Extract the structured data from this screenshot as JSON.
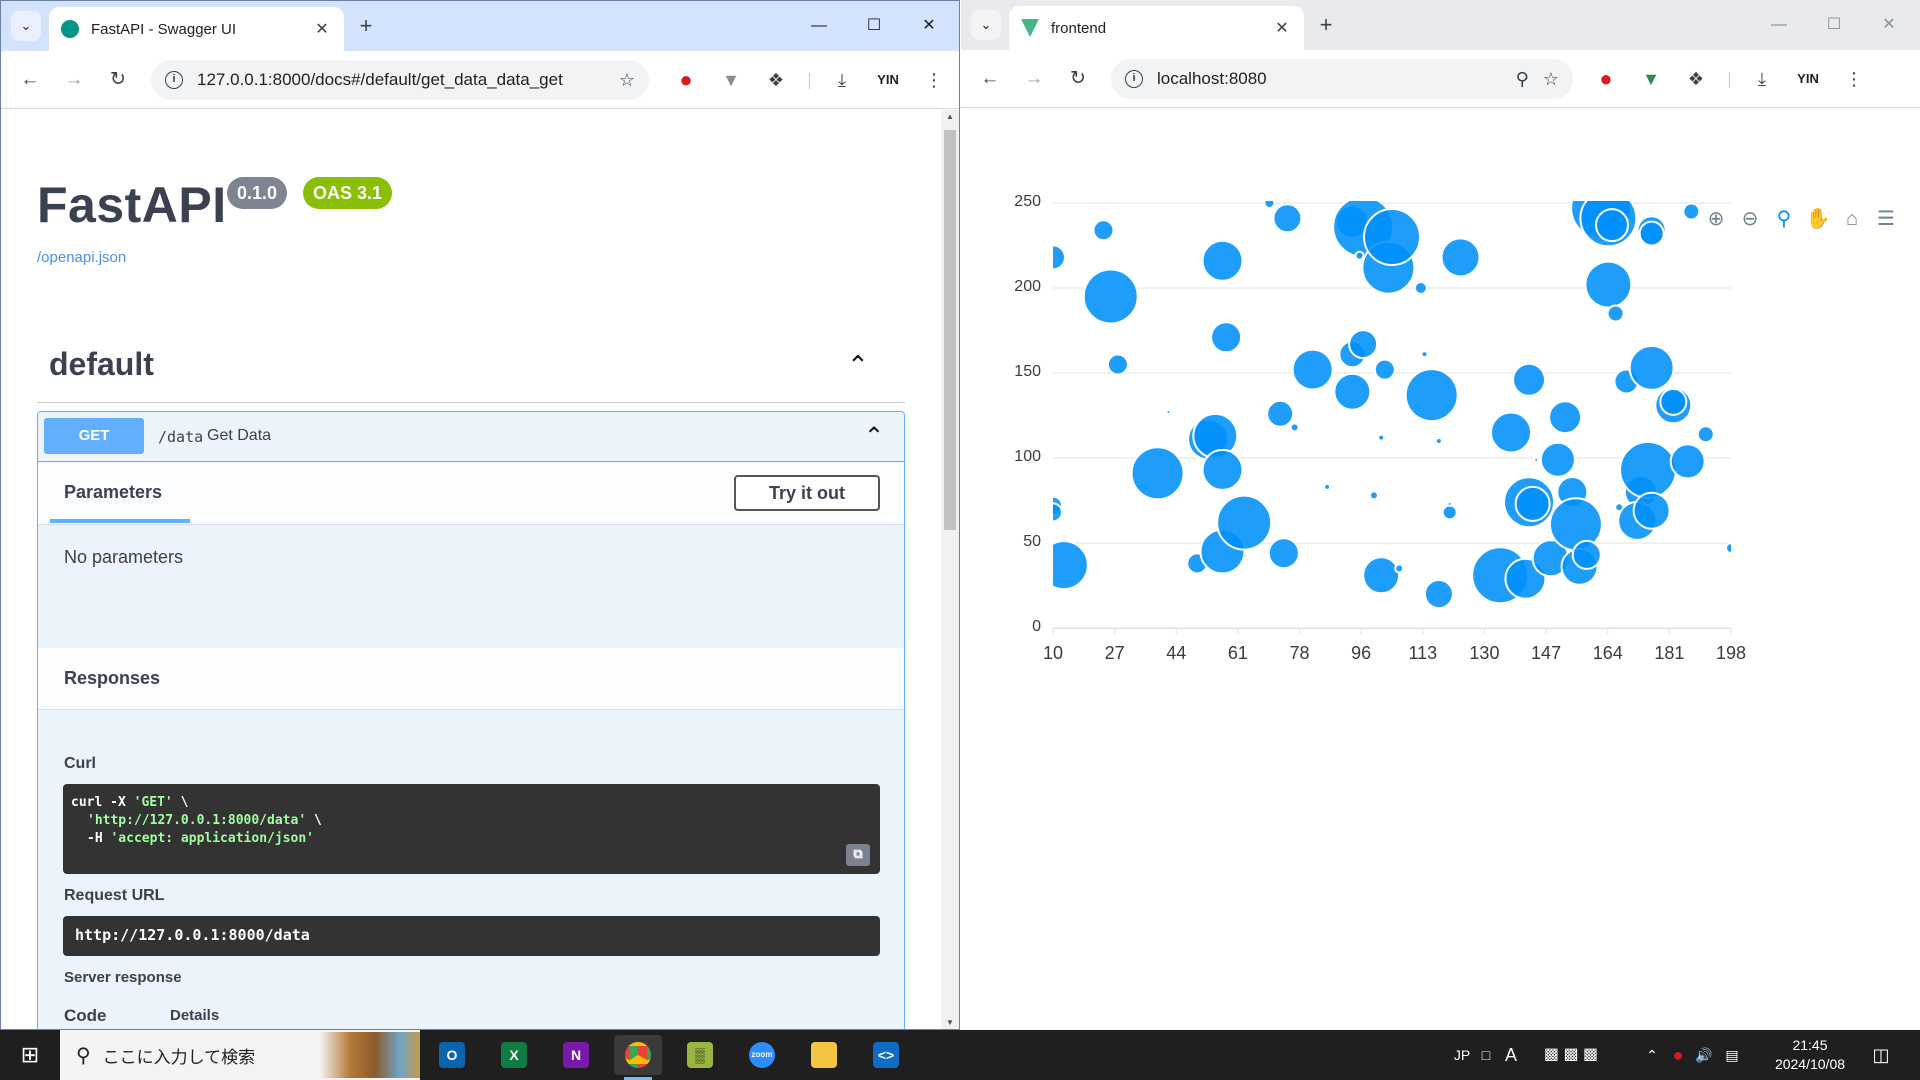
{
  "left_browser": {
    "tab_title": "FastAPI - Swagger UI",
    "url": "127.0.0.1:8000/docs#/default/get_data_data_get",
    "profile": "YIN"
  },
  "swagger": {
    "title": "FastAPI",
    "version_badge": "0.1.0",
    "oas_badge": "OAS 3.1",
    "openapi_link": "/openapi.json",
    "tag": "default",
    "operation": {
      "method": "GET",
      "path": "/data",
      "summary": "Get Data",
      "parameters_label": "Parameters",
      "try_button": "Try it out",
      "no_params": "No parameters",
      "responses_label": "Responses",
      "curl_label": "Curl",
      "curl_line1_cmd": "curl -X ",
      "curl_line1_arg": "'GET'",
      "curl_line1_end": " \\",
      "curl_line2_arg": "'http://127.0.0.1:8000/data'",
      "curl_line2_end": " \\",
      "curl_line3_cmd": "-H ",
      "curl_line3_arg": "'accept: application/json'",
      "request_url_label": "Request URL",
      "request_url": "http://127.0.0.1:8000/data",
      "server_response_label": "Server response",
      "code_header": "Code",
      "details_header": "Details"
    },
    "colors": {
      "get_blue": "#61affe",
      "badge_gray": "#89bf04",
      "title": "#3b4151"
    }
  },
  "right_browser": {
    "tab_title": "frontend",
    "url": "localhost:8080",
    "profile": "YIN"
  },
  "chart_data": {
    "type": "bubble",
    "title": "",
    "xlabel": "",
    "ylabel": "",
    "x_ticks": [
      "10",
      "27",
      "44",
      "61",
      "78",
      "96",
      "113",
      "130",
      "147",
      "164",
      "181",
      "198"
    ],
    "y_ticks": [
      "0",
      "50",
      "100",
      "150",
      "200",
      "250"
    ],
    "xlim": [
      10,
      198
    ],
    "ylim": [
      0,
      250
    ],
    "grid": true,
    "color": "#008ffb",
    "toolbar_icons": [
      "zoom-in-icon",
      "zoom-out-icon",
      "zoom-select-icon",
      "pan-icon",
      "reset-home-icon",
      "menu-icon"
    ],
    "points": [
      {
        "x": 10,
        "y": 218,
        "r": 12
      },
      {
        "x": 24,
        "y": 234,
        "r": 10
      },
      {
        "x": 26,
        "y": 195,
        "r": 27
      },
      {
        "x": 28,
        "y": 155,
        "r": 10
      },
      {
        "x": 13,
        "y": 37,
        "r": 24
      },
      {
        "x": 10,
        "y": 72,
        "r": 9
      },
      {
        "x": 10,
        "y": 68,
        "r": 9
      },
      {
        "x": 39,
        "y": 91,
        "r": 26
      },
      {
        "x": 42,
        "y": 127,
        "r": 2
      },
      {
        "x": 50,
        "y": 38,
        "r": 10
      },
      {
        "x": 53,
        "y": 111,
        "r": 20
      },
      {
        "x": 55,
        "y": 113,
        "r": 22
      },
      {
        "x": 57,
        "y": 216,
        "r": 20
      },
      {
        "x": 58,
        "y": 171,
        "r": 15
      },
      {
        "x": 57,
        "y": 93,
        "r": 20
      },
      {
        "x": 57,
        "y": 45,
        "r": 22
      },
      {
        "x": 63,
        "y": 62,
        "r": 27
      },
      {
        "x": 70,
        "y": 250,
        "r": 5
      },
      {
        "x": 73,
        "y": 126,
        "r": 13
      },
      {
        "x": 74,
        "y": 44,
        "r": 15
      },
      {
        "x": 75,
        "y": 241,
        "r": 14
      },
      {
        "x": 77,
        "y": 118,
        "r": 4
      },
      {
        "x": 82,
        "y": 152,
        "r": 20
      },
      {
        "x": 86,
        "y": 83,
        "r": 3
      },
      {
        "x": 93,
        "y": 161,
        "r": 13
      },
      {
        "x": 93,
        "y": 139,
        "r": 18
      },
      {
        "x": 93,
        "y": 239,
        "r": 16
      },
      {
        "x": 96,
        "y": 167,
        "r": 14
      },
      {
        "x": 96,
        "y": 236,
        "r": 30
      },
      {
        "x": 95,
        "y": 219,
        "r": 4
      },
      {
        "x": 99,
        "y": 78,
        "r": 4
      },
      {
        "x": 101,
        "y": 112,
        "r": 3
      },
      {
        "x": 102,
        "y": 152,
        "r": 10
      },
      {
        "x": 103,
        "y": 212,
        "r": 26
      },
      {
        "x": 104,
        "y": 230,
        "r": 28
      },
      {
        "x": 101,
        "y": 31,
        "r": 18
      },
      {
        "x": 106,
        "y": 35,
        "r": 4
      },
      {
        "x": 112,
        "y": 200,
        "r": 6
      },
      {
        "x": 113,
        "y": 161,
        "r": 3
      },
      {
        "x": 115,
        "y": 137,
        "r": 26
      },
      {
        "x": 117,
        "y": 110,
        "r": 3
      },
      {
        "x": 117,
        "y": 20,
        "r": 14
      },
      {
        "x": 120,
        "y": 68,
        "r": 7
      },
      {
        "x": 120,
        "y": 73,
        "r": 2
      },
      {
        "x": 123,
        "y": 218,
        "r": 19
      },
      {
        "x": 134,
        "y": 31,
        "r": 28
      },
      {
        "x": 137,
        "y": 115,
        "r": 20
      },
      {
        "x": 141,
        "y": 29,
        "r": 20
      },
      {
        "x": 142,
        "y": 146,
        "r": 16
      },
      {
        "x": 142,
        "y": 74,
        "r": 25
      },
      {
        "x": 143,
        "y": 73,
        "r": 17
      },
      {
        "x": 144,
        "y": 99,
        "r": 2
      },
      {
        "x": 148,
        "y": 41,
        "r": 18
      },
      {
        "x": 150,
        "y": 99,
        "r": 17
      },
      {
        "x": 152,
        "y": 124,
        "r": 16
      },
      {
        "x": 154,
        "y": 80,
        "r": 15
      },
      {
        "x": 155,
        "y": 61,
        "r": 26
      },
      {
        "x": 156,
        "y": 36,
        "r": 18
      },
      {
        "x": 158,
        "y": 43,
        "r": 14
      },
      {
        "x": 162,
        "y": 247,
        "r": 30
      },
      {
        "x": 164,
        "y": 241,
        "r": 28
      },
      {
        "x": 165,
        "y": 237,
        "r": 16
      },
      {
        "x": 164,
        "y": 202,
        "r": 23
      },
      {
        "x": 166,
        "y": 185,
        "r": 8
      },
      {
        "x": 167,
        "y": 71,
        "r": 4
      },
      {
        "x": 169,
        "y": 145,
        "r": 12
      },
      {
        "x": 173,
        "y": 80,
        "r": 16
      },
      {
        "x": 175,
        "y": 93,
        "r": 28
      },
      {
        "x": 172,
        "y": 63,
        "r": 19
      },
      {
        "x": 176,
        "y": 69,
        "r": 18
      },
      {
        "x": 176,
        "y": 153,
        "r": 22
      },
      {
        "x": 176,
        "y": 234,
        "r": 14
      },
      {
        "x": 176,
        "y": 232,
        "r": 12
      },
      {
        "x": 182,
        "y": 131,
        "r": 18
      },
      {
        "x": 182,
        "y": 133,
        "r": 13
      },
      {
        "x": 186,
        "y": 98,
        "r": 17
      },
      {
        "x": 187,
        "y": 245,
        "r": 8
      },
      {
        "x": 191,
        "y": 114,
        "r": 8
      },
      {
        "x": 198,
        "y": 47,
        "r": 5
      }
    ]
  },
  "taskbar": {
    "search_placeholder": "ここに入力して検索",
    "ime": "JP",
    "time": "21:45",
    "date": "2024/10/08"
  }
}
